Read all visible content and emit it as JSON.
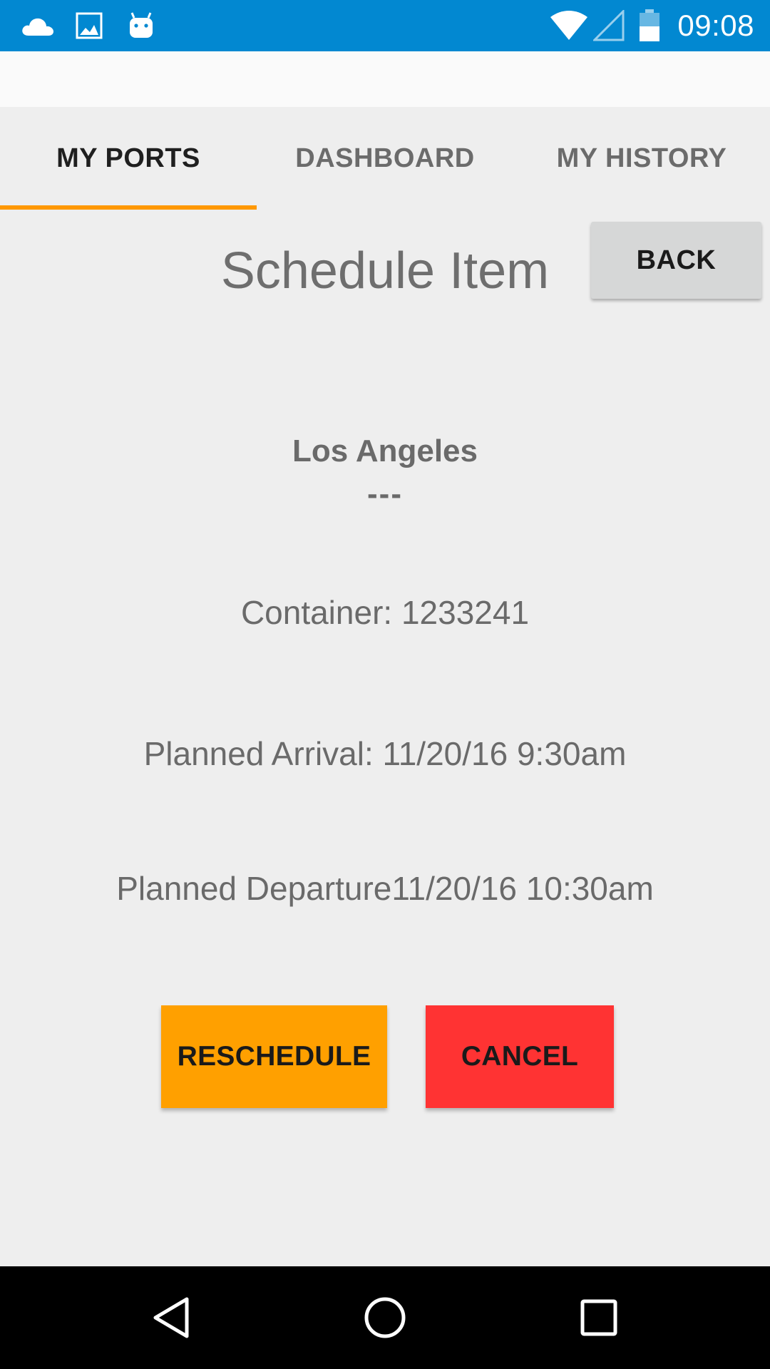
{
  "status_bar": {
    "time": "09:08",
    "left_icons": [
      "cloud-icon",
      "image-icon",
      "android-icon"
    ],
    "right_icons": [
      "wifi-icon",
      "cell-signal-icon",
      "battery-icon"
    ],
    "color": "#0288d1"
  },
  "tabs": [
    {
      "label": "MY PORTS",
      "active": true
    },
    {
      "label": "DASHBOARD",
      "active": false
    },
    {
      "label": "MY HISTORY",
      "active": false
    }
  ],
  "accent_color": "#ff9800",
  "header": {
    "title": "Schedule Item",
    "back_label": "BACK"
  },
  "schedule": {
    "port_name": "Los Angeles",
    "port_sub": "---",
    "container": "Container: 1233241",
    "planned_arrival": "Planned Arrival: 11/20/16 9:30am",
    "planned_departure": "Planned Departure11/20/16 10:30am"
  },
  "actions": {
    "reschedule_label": "RESCHEDULE",
    "reschedule_color": "#ffa000",
    "cancel_label": "CANCEL",
    "cancel_color": "#ff3333"
  },
  "nav_bar": {
    "icons": [
      "back-triangle-icon",
      "home-circle-icon",
      "recents-square-icon"
    ]
  }
}
